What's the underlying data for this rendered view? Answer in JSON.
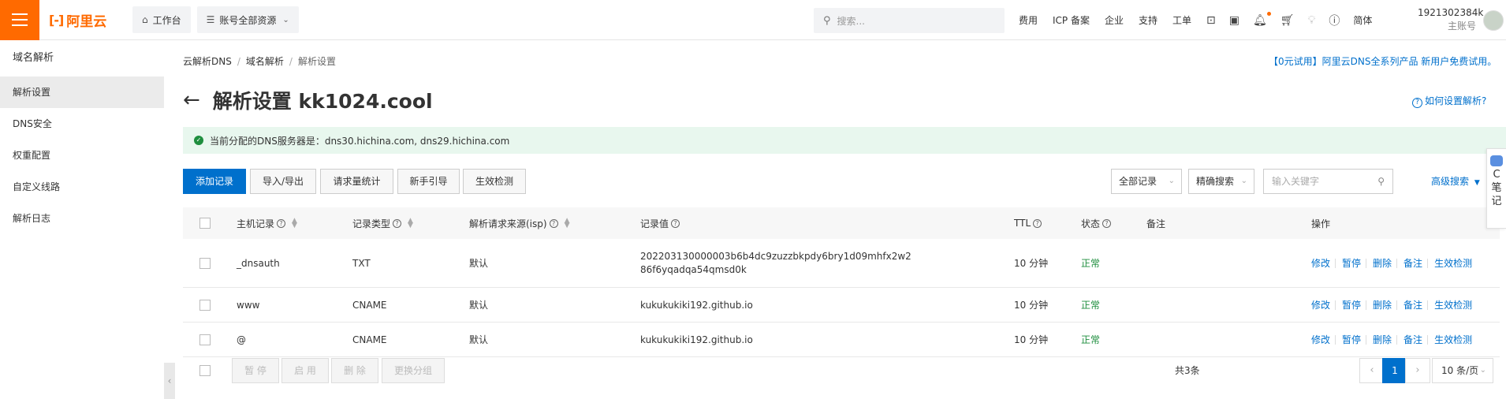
{
  "topbar": {
    "logo_text": "阿里云",
    "workbench": "工作台",
    "resources": "账号全部资源",
    "search_placeholder": "搜索...",
    "links": [
      "费用",
      "ICP 备案",
      "企业",
      "支持",
      "工单"
    ],
    "lang": "简体",
    "user_id": "1921302384k",
    "user_role": "主账号"
  },
  "sidebar": {
    "title": "域名解析",
    "items": [
      "解析设置",
      "DNS安全",
      "权重配置",
      "自定义线路",
      "解析日志"
    ]
  },
  "breadcrumb": [
    "云解析DNS",
    "域名解析",
    "解析设置"
  ],
  "promo": "【0元试用】阿里云DNS全系列产品 新用户免费试用。",
  "page_title": "解析设置 kk1024.cool",
  "help_link": "如何设置解析?",
  "alert": "当前分配的DNS服务器是：dns30.hichina.com, dns29.hichina.com",
  "toolbar": {
    "add": "添加记录",
    "import_export": "导入/导出",
    "request_stats": "请求量统计",
    "guide": "新手引导",
    "check": "生效检测",
    "filter_all": "全部记录",
    "search_mode": "精确搜索",
    "keyword_placeholder": "输入关键字",
    "advanced": "高级搜索"
  },
  "table": {
    "headers": {
      "host": "主机记录",
      "type": "记录类型",
      "isp": "解析请求来源(isp)",
      "value": "记录值",
      "ttl": "TTL",
      "status": "状态",
      "remark": "备注",
      "ops": "操作"
    },
    "rows": [
      {
        "host": "_dnsauth",
        "type": "TXT",
        "isp": "默认",
        "value_line1": "202203130000003b6b4dc9zuzzbkpdy6bry1d09mhfx2w2",
        "value_line2": "86f6yqadqa54qmsd0k",
        "ttl": "10 分钟",
        "status": "正常"
      },
      {
        "host": "www",
        "type": "CNAME",
        "isp": "默认",
        "value_line1": "kukukukiki192.github.io",
        "value_line2": "",
        "ttl": "10 分钟",
        "status": "正常"
      },
      {
        "host": "@",
        "type": "CNAME",
        "isp": "默认",
        "value_line1": "kukukukiki192.github.io",
        "value_line2": "",
        "ttl": "10 分钟",
        "status": "正常"
      }
    ],
    "row_ops": [
      "修改",
      "暂停",
      "删除",
      "备注",
      "生效检测"
    ]
  },
  "footer": {
    "pause": "暂 停",
    "enable": "启 用",
    "delete": "删 除",
    "change_group": "更换分组",
    "total": "共3条",
    "current_page": "1",
    "page_size": "10 条/页"
  },
  "float_note": {
    "line1": "C",
    "line2": "笔",
    "line3": "记"
  }
}
